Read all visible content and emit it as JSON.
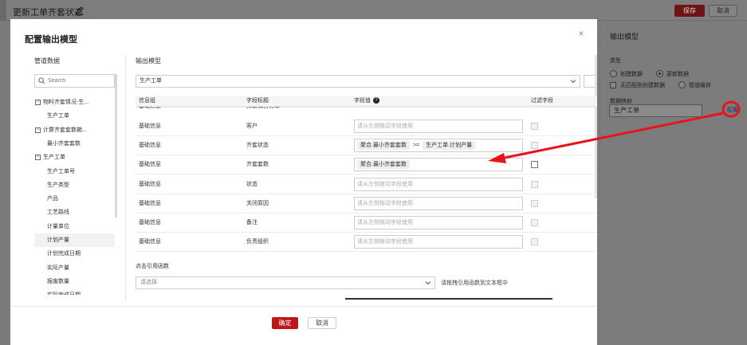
{
  "background": {
    "title": "更新工单齐套状态",
    "save_label": "保存",
    "cancel_label": "取消",
    "side": {
      "title": "输出模型",
      "type_label": "类型",
      "radio_create": "创建数据",
      "radio_update": "更新数据",
      "checkbox_no_match": "无匹配则创建数据",
      "radio_pipeline": "管道缓存",
      "mapping_label": "数据映射",
      "mapping_value": "生产工单",
      "config_link": "配置"
    }
  },
  "modal": {
    "title": "配置输出模型",
    "close": "×",
    "pipeline": {
      "title": "管道数据",
      "search_placeholder": "Search",
      "tree": [
        {
          "label": "物料齐套情况-生...",
          "level": 0,
          "toggle": "−"
        },
        {
          "label": "生产工单",
          "level": 1
        },
        {
          "label": "计算齐套套数箱...",
          "level": 0,
          "toggle": "−"
        },
        {
          "label": "最小齐套套数",
          "level": 1
        },
        {
          "label": "生产工单",
          "level": 0,
          "toggle": "−"
        },
        {
          "label": "生产工单号",
          "level": 1
        },
        {
          "label": "生产类型",
          "level": 1
        },
        {
          "label": "产品",
          "level": 1
        },
        {
          "label": "工艺路线",
          "level": 1
        },
        {
          "label": "计量单位",
          "level": 1
        },
        {
          "label": "计划产量",
          "level": 1,
          "selected": true
        },
        {
          "label": "计划完成日期",
          "level": 1
        },
        {
          "label": "实际产量",
          "level": 1
        },
        {
          "label": "报废数量",
          "level": 1
        },
        {
          "label": "实际完成日期",
          "level": 1
        }
      ]
    },
    "output": {
      "title": "输出模型",
      "model_value": "生产工单",
      "columns": {
        "group": "信息组",
        "field_title": "字段标题",
        "field_value": "字段值",
        "help": "?",
        "filter": "过滤字段"
      },
      "rows": [
        {
          "group": "基础信息",
          "title": "关联销售订单",
          "placeholder": "",
          "tags": [],
          "filter": false,
          "partial": true
        },
        {
          "group": "基础信息",
          "title": "客户",
          "placeholder": "请从左侧拖动字段使用",
          "tags": [],
          "filter": false
        },
        {
          "group": "基础信息",
          "title": "齐套状态",
          "placeholder": "",
          "tags": [
            "聚合.最小齐套套数"
          ],
          "op": ">=",
          "tags2": [
            "生产工单.计划产量"
          ],
          "filter": false
        },
        {
          "group": "基础信息",
          "title": "齐套套数",
          "placeholder": "",
          "tags": [
            "聚合.最小齐套套数"
          ],
          "filter": true
        },
        {
          "group": "基础信息",
          "title": "状态",
          "placeholder": "请从左侧拖动字段使用",
          "tags": [],
          "filter": false
        },
        {
          "group": "基础信息",
          "title": "关闭原因",
          "placeholder": "请从左侧拖动字段使用",
          "tags": [],
          "filter": false
        },
        {
          "group": "基础信息",
          "title": "备注",
          "placeholder": "请从左侧拖动字段使用",
          "tags": [],
          "filter": false
        },
        {
          "group": "基础信息",
          "title": "负责组织",
          "placeholder": "请从左侧拖动字段使用",
          "tags": [],
          "filter": false
        }
      ],
      "function_title": "点击引用函数",
      "function_placeholder": "请选择",
      "function_hint": "请拖拽引用函数到文本框中"
    },
    "ok_label": "确定",
    "cancel_label": "取消"
  },
  "colors": {
    "primary_red": "#c0161a",
    "annotation_red": "#e8141b"
  }
}
